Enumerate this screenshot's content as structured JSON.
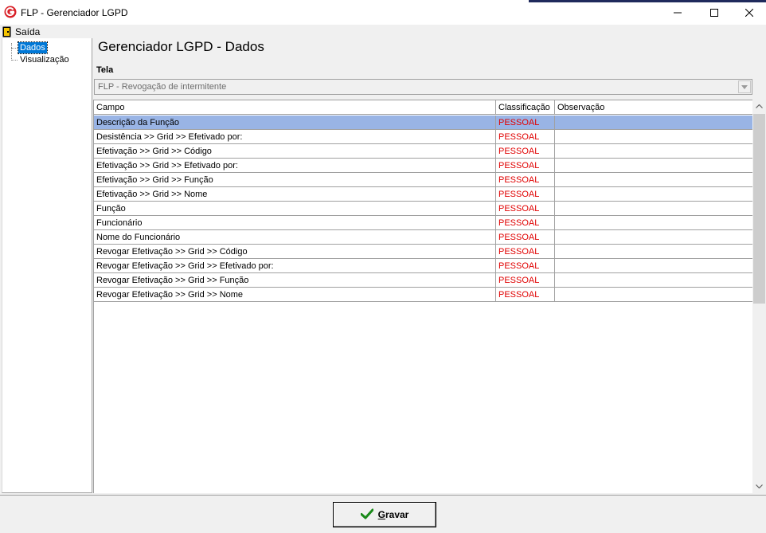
{
  "window": {
    "title": "FLP - Gerenciador LGPD",
    "controls": {
      "minimize": "—",
      "maximize": "☐",
      "close": "✕"
    }
  },
  "menu": {
    "items": [
      {
        "label": "Saída",
        "icon": "door-exit-icon"
      }
    ]
  },
  "tree": {
    "items": [
      {
        "label": "Dados",
        "selected": true
      },
      {
        "label": "Visualização",
        "selected": false
      }
    ]
  },
  "main": {
    "title": "Gerenciador LGPD - Dados",
    "tela_label": "Tela",
    "tela_value": "FLP - Revogação de intermitente"
  },
  "grid": {
    "columns": [
      "Campo",
      "Classificação",
      "Observação"
    ],
    "rows": [
      {
        "campo": "Descrição da Função",
        "classificacao": "PESSOAL",
        "observacao": ""
      },
      {
        "campo": "Desistência >> Grid >> Efetivado por:",
        "classificacao": "PESSOAL",
        "observacao": ""
      },
      {
        "campo": "Efetivação >> Grid >> Código",
        "classificacao": "PESSOAL",
        "observacao": ""
      },
      {
        "campo": "Efetivação >> Grid >> Efetivado por:",
        "classificacao": "PESSOAL",
        "observacao": ""
      },
      {
        "campo": "Efetivação >> Grid >> Função",
        "classificacao": "PESSOAL",
        "observacao": ""
      },
      {
        "campo": "Efetivação >> Grid >> Nome",
        "classificacao": "PESSOAL",
        "observacao": ""
      },
      {
        "campo": "Função",
        "classificacao": "PESSOAL",
        "observacao": ""
      },
      {
        "campo": "Funcionário",
        "classificacao": "PESSOAL",
        "observacao": ""
      },
      {
        "campo": "Nome do Funcionário",
        "classificacao": "PESSOAL",
        "observacao": ""
      },
      {
        "campo": "Revogar Efetivação >> Grid >> Código",
        "classificacao": "PESSOAL",
        "observacao": ""
      },
      {
        "campo": "Revogar Efetivação >> Grid >> Efetivado por:",
        "classificacao": "PESSOAL",
        "observacao": ""
      },
      {
        "campo": "Revogar Efetivação >> Grid >> Função",
        "classificacao": "PESSOAL",
        "observacao": ""
      },
      {
        "campo": "Revogar Efetivação >> Grid >> Nome",
        "classificacao": "PESSOAL",
        "observacao": ""
      }
    ],
    "selected_row": 0
  },
  "footer": {
    "save_first": "G",
    "save_rest": "ravar"
  },
  "colors": {
    "selection": "#99b4e5",
    "classification_text": "#e00000",
    "tree_selection": "#0078d7"
  }
}
